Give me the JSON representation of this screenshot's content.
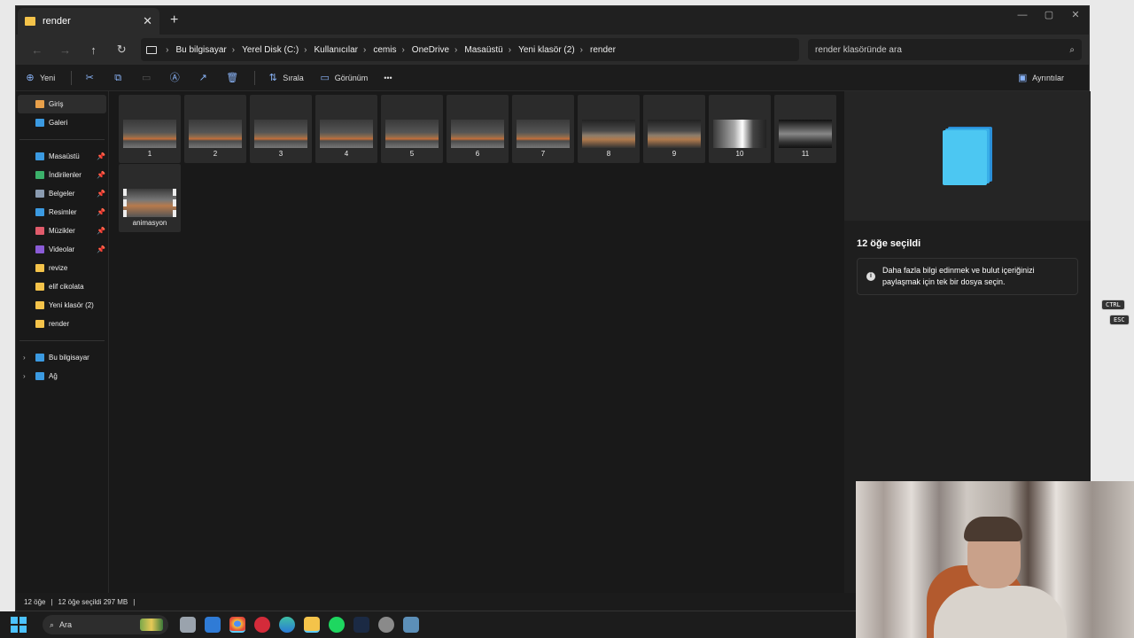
{
  "tab": {
    "title": "render",
    "close": "✕",
    "new": "+"
  },
  "window_controls": {
    "minimize": "—",
    "maximize": "▢",
    "close": "✕"
  },
  "nav": {
    "back": "←",
    "forward": "→",
    "up": "↑",
    "refresh": "↻"
  },
  "breadcrumbs": [
    "Bu bilgisayar",
    "Yerel Disk (C:)",
    "Kullanıcılar",
    "cemis",
    "OneDrive",
    "Masaüstü",
    "Yeni klasör (2)",
    "render"
  ],
  "search": {
    "placeholder": "render klasöründe ara"
  },
  "toolbar": {
    "new": "Yeni",
    "sort": "Sırala",
    "view": "Görünüm",
    "more": "•••",
    "details": "Ayrıntılar"
  },
  "sidebar": {
    "top": [
      {
        "label": "Giriş",
        "color": "#e8a04a"
      },
      {
        "label": "Galeri",
        "color": "#3b9ae1"
      }
    ],
    "pinned": [
      {
        "label": "Masaüstü",
        "color": "#3b9ae1"
      },
      {
        "label": "İndirilenler",
        "color": "#3bb16a"
      },
      {
        "label": "Belgeler",
        "color": "#8a9bb0"
      },
      {
        "label": "Resimler",
        "color": "#3b9ae1"
      },
      {
        "label": "Müzikler",
        "color": "#e05b6b"
      },
      {
        "label": "Videolar",
        "color": "#8a5bd6"
      }
    ],
    "folders": [
      {
        "label": "revize"
      },
      {
        "label": "elif cikolata"
      },
      {
        "label": "Yeni klasör (2)"
      },
      {
        "label": "render"
      }
    ],
    "bottom": [
      {
        "label": "Bu bilgisayar",
        "color": "#3b9ae1"
      },
      {
        "label": "Ağ",
        "color": "#3b9ae1"
      }
    ]
  },
  "files": [
    {
      "name": "1",
      "style": "img"
    },
    {
      "name": "2",
      "style": "img"
    },
    {
      "name": "3",
      "style": "img"
    },
    {
      "name": "4",
      "style": "img"
    },
    {
      "name": "5",
      "style": "img"
    },
    {
      "name": "6",
      "style": "img"
    },
    {
      "name": "7",
      "style": "img"
    },
    {
      "name": "8",
      "style": "dark"
    },
    {
      "name": "9",
      "style": "dark"
    },
    {
      "name": "10",
      "style": "white"
    },
    {
      "name": "11",
      "style": "plan"
    },
    {
      "name": "animasyon",
      "style": "vid"
    }
  ],
  "details": {
    "count_label": "12 öğe seçildi",
    "info_line1": "Daha fazla bilgi edinmek ve bulut içeriğinizi",
    "info_line2": "paylaşmak için tek bir dosya seçin."
  },
  "status": {
    "items": "12 öğe",
    "selected": "12 öğe seçildi  297 MB"
  },
  "taskbar": {
    "search": "Ara"
  },
  "keys": {
    "ctrl": "CTRL",
    "esc": "ESC"
  },
  "colors": {
    "folder": "#f4c34a",
    "accent": "#4cc2ff"
  }
}
